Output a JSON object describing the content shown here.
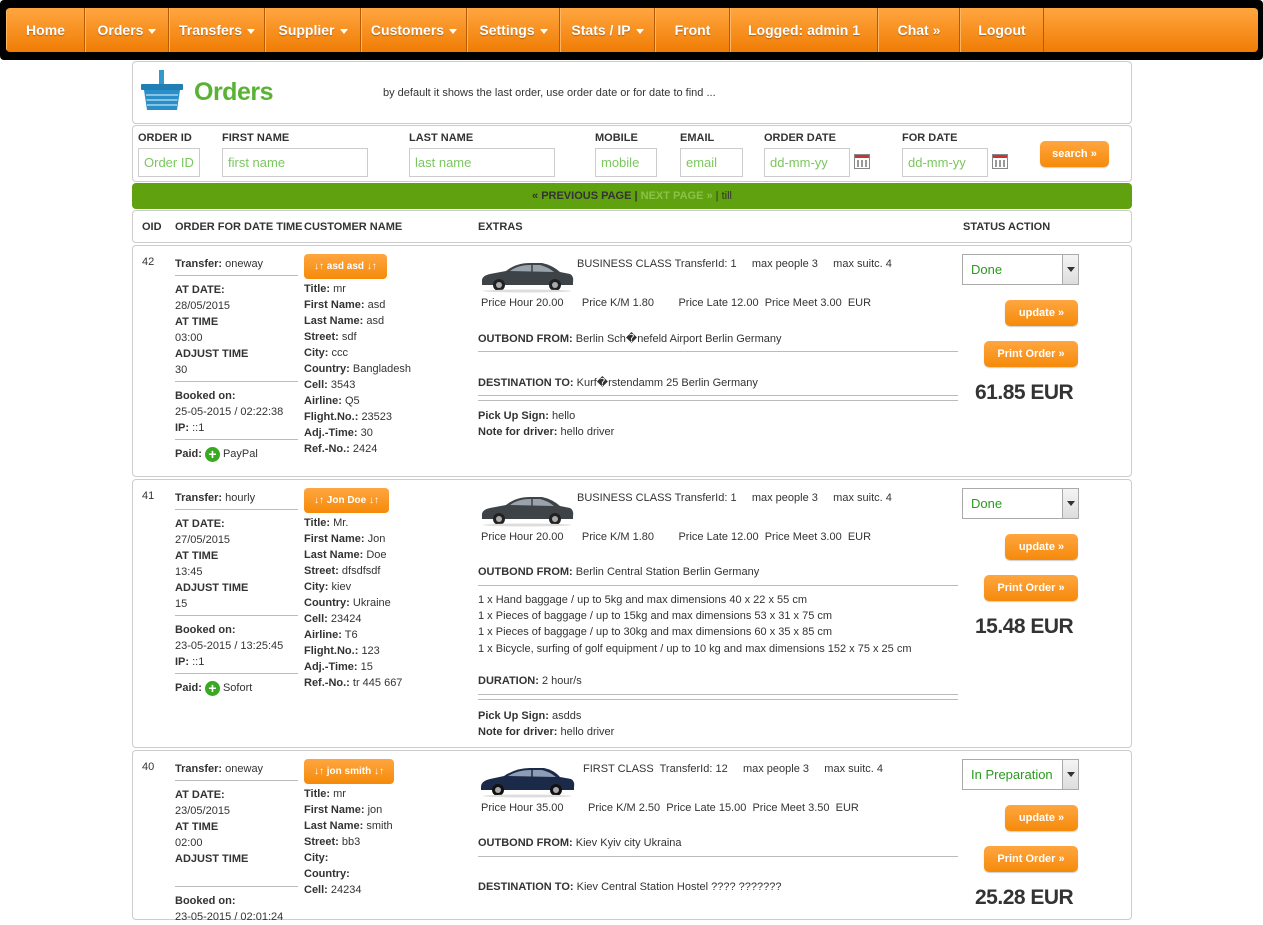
{
  "nav": [
    {
      "label": "Home",
      "dropdown": false
    },
    {
      "label": "Orders",
      "dropdown": true
    },
    {
      "label": "Transfers",
      "dropdown": true
    },
    {
      "label": "Supplier",
      "dropdown": true
    },
    {
      "label": "Customers",
      "dropdown": true
    },
    {
      "label": "Settings",
      "dropdown": true
    },
    {
      "label": "Stats / IP",
      "dropdown": true
    },
    {
      "label": "Front",
      "dropdown": false
    },
    {
      "label": "Logged: admin 1",
      "dropdown": false
    },
    {
      "label": "Chat »",
      "dropdown": false
    },
    {
      "label": "Logout",
      "dropdown": false
    }
  ],
  "header": {
    "title": "Orders",
    "hint": "by default it shows the last order, use order date or for date to find ...",
    "icon": "basket-icon"
  },
  "filters": {
    "order_id": {
      "label": "ORDER ID",
      "placeholder": "Order ID"
    },
    "first_name": {
      "label": "FIRST NAME",
      "placeholder": "first name"
    },
    "last_name": {
      "label": "LAST NAME",
      "placeholder": "last name"
    },
    "mobile": {
      "label": "MOBILE",
      "placeholder": "mobile"
    },
    "email": {
      "label": "EMAIL",
      "placeholder": "email"
    },
    "order_date": {
      "label": "ORDER DATE",
      "placeholder": "dd-mm-yy"
    },
    "for_date": {
      "label": "FOR DATE",
      "placeholder": "dd-mm-yy"
    },
    "search_label": "search »"
  },
  "pager": {
    "prev": "« PREVIOUS PAGE",
    "sep": " | ",
    "next": "NEXT PAGE »",
    "sep2": " | ",
    "till": "till"
  },
  "columns": {
    "oid": "OID",
    "date": "ORDER FOR DATE TIME",
    "customer": "CUSTOMER NAME",
    "extras": "EXTRAS",
    "status": "STATUS ACTION"
  },
  "labels": {
    "transfer": "Transfer:",
    "at_date": "AT DATE:",
    "at_time": "AT TIME",
    "adjust_time": "ADJUST TIME",
    "booked_on": "Booked on:",
    "ip": "IP:",
    "paid": "Paid:",
    "title": "Title:",
    "first_name": "First Name:",
    "last_name": "Last Name:",
    "street": "Street:",
    "city": "City:",
    "country": "Country:",
    "cell": "Cell:",
    "airline": "Airline:",
    "flight": "Flight.No.:",
    "adj_time": "Adj.-Time:",
    "ref": "Ref.-No.:",
    "outbond": "OUTBOND FROM:",
    "destination": "DESTINATION TO:",
    "duration": "DURATION:",
    "pickup": "Pick Up Sign:",
    "note": "Note for driver:",
    "update": "update »",
    "print": "Print Order »"
  },
  "orders": [
    {
      "oid": "42",
      "transfer": "oneway",
      "at_date": "28/05/2015",
      "at_time": "03:00",
      "adjust_time": "30",
      "booked_on": "25-05-2015 / 02:22:38",
      "ip": "::1",
      "paid": "PayPal",
      "name_btn": "↓↑ asd  asd ↓↑",
      "title": "mr",
      "first_name": "asd",
      "last_name": "asd",
      "street": "sdf",
      "city": "ccc",
      "country": "Bangladesh",
      "cell": "3543",
      "airline": "Q5",
      "flight": "23523",
      "adj_time": "30",
      "ref": "2424",
      "car_info": "BUSINESS CLASS TransferId: 1     max people 3     max suitc. 4",
      "prices": "Price Hour 20.00      Price K/M 1.80        Price Late 12.00  Price Meet 3.00  EUR",
      "outbond": "Berlin Sch�nefeld Airport Berlin Germany",
      "destination": "Kurf�rstendamm 25 Berlin Germany",
      "pickup": "hello",
      "note": "hello driver",
      "status": "Done",
      "price": "61.85 EUR"
    },
    {
      "oid": "41",
      "transfer": "hourly",
      "at_date": "27/05/2015",
      "at_time": "13:45",
      "adjust_time": "15",
      "booked_on": "23-05-2015 / 13:25:45",
      "ip": "::1",
      "paid": "Sofort",
      "name_btn": "↓↑ Jon  Doe ↓↑",
      "title": "Mr.",
      "first_name": "Jon",
      "last_name": "Doe",
      "street": "dfsdfsdf",
      "city": "kiev",
      "country": "Ukraine",
      "cell": "23424",
      "airline": "T6",
      "flight": "123",
      "adj_time": "15",
      "ref": "tr 445 667",
      "car_info": "BUSINESS CLASS TransferId: 1     max people 3     max suitc. 4",
      "prices": "Price Hour 20.00      Price K/M 1.80        Price Late 12.00  Price Meet 3.00  EUR",
      "outbond": "Berlin Central Station Berlin Germany",
      "baggage": [
        "1 x Hand baggage / up to 5kg and max dimensions 40 x 22 x 55 cm",
        "1 x Pieces of baggage / up to 15kg and max dimensions 53 x 31 x 75 cm",
        "1 x Pieces of baggage / up to 30kg and max dimensions 60 x 35 x 85 cm",
        "1 x Bicycle, surfing of golf equipment / up to 10 kg and max dimensions 152 x 75 x 25 cm"
      ],
      "duration": "2 hour/s",
      "pickup": "asdds",
      "note": "hello driver",
      "status": "Done",
      "price": "15.48 EUR"
    },
    {
      "oid": "40",
      "transfer": "oneway",
      "at_date": "23/05/2015",
      "at_time": "02:00",
      "booked_on": "23-05-2015 / 02:01:24",
      "paid": "",
      "name_btn": "↓↑ jon  smith ↓↑",
      "title": "mr",
      "first_name": "jon",
      "last_name": "smith",
      "street": "bb3",
      "city": "",
      "country": "",
      "cell": "24234",
      "car_info": "FIRST CLASS  TransferId: 12     max people 3     max suitc. 4",
      "prices": "Price Hour 35.00        Price K/M 2.50  Price Late 15.00  Price Meet 3.50  EUR",
      "outbond": "Kiev Kyiv city Ukraina",
      "destination": "Kiev Central Station Hostel ???? ???????",
      "status": "In Preparation",
      "price": "25.28 EUR"
    }
  ]
}
